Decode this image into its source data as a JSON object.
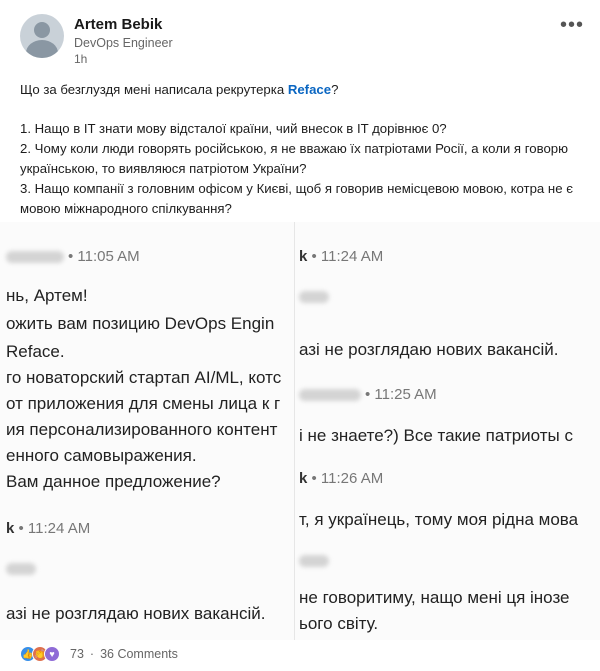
{
  "post": {
    "author": "Artem Bebik",
    "headline": "DevOps Engineer",
    "time": "1h",
    "more_icon": "ellipsis-icon",
    "intro_before": "Що за безглуздя мені написала рекрутерка ",
    "mention": "Reface",
    "intro_after": "?",
    "points": [
      "1. Нащо в IT знати мову відсталої країни, чий внесок в IT дорівнює 0?",
      "2. Чому коли люди говорять російською, я не вважаю їх патріотами Росії, а коли я говорю українською, то виявляюся патріотом України?",
      "3. Нащо компанії з головним офісом у Києві, щоб я говорив немісцевою мовою, котра не є мовою міжнародного спілкування?"
    ]
  },
  "screenshot": {
    "left": {
      "time1": "• 11:05 AM",
      "lines": [
        "нь, Артем!",
        "ожить вам позицию DevOps Engin",
        "Reface.",
        "го новаторский стартап AI/ML, котс",
        "от приложения для смены лица к г",
        "ия персонализированного контент",
        "енного самовыражения.",
        "Вам данное предложение?"
      ],
      "name2": "k",
      "time2": "• 11:24 AM",
      "line_bottom": "азі не розглядаю нових вакансій."
    },
    "right": {
      "name1": "k",
      "time1": "• 11:24 AM",
      "line1": "азі не розглядаю нових вакансій.",
      "time2": "• 11:25 AM",
      "line2": "і не знаете?) Все такие патриоты с",
      "name3": "k",
      "time3": "• 11:26 AM",
      "line3": "т, я українець, тому моя рідна мова",
      "line4": "не говоритиму, нащо мені ця інозе",
      "line5": "ього світу."
    }
  },
  "footer": {
    "reactions": "73",
    "comments": "36 Comments"
  }
}
